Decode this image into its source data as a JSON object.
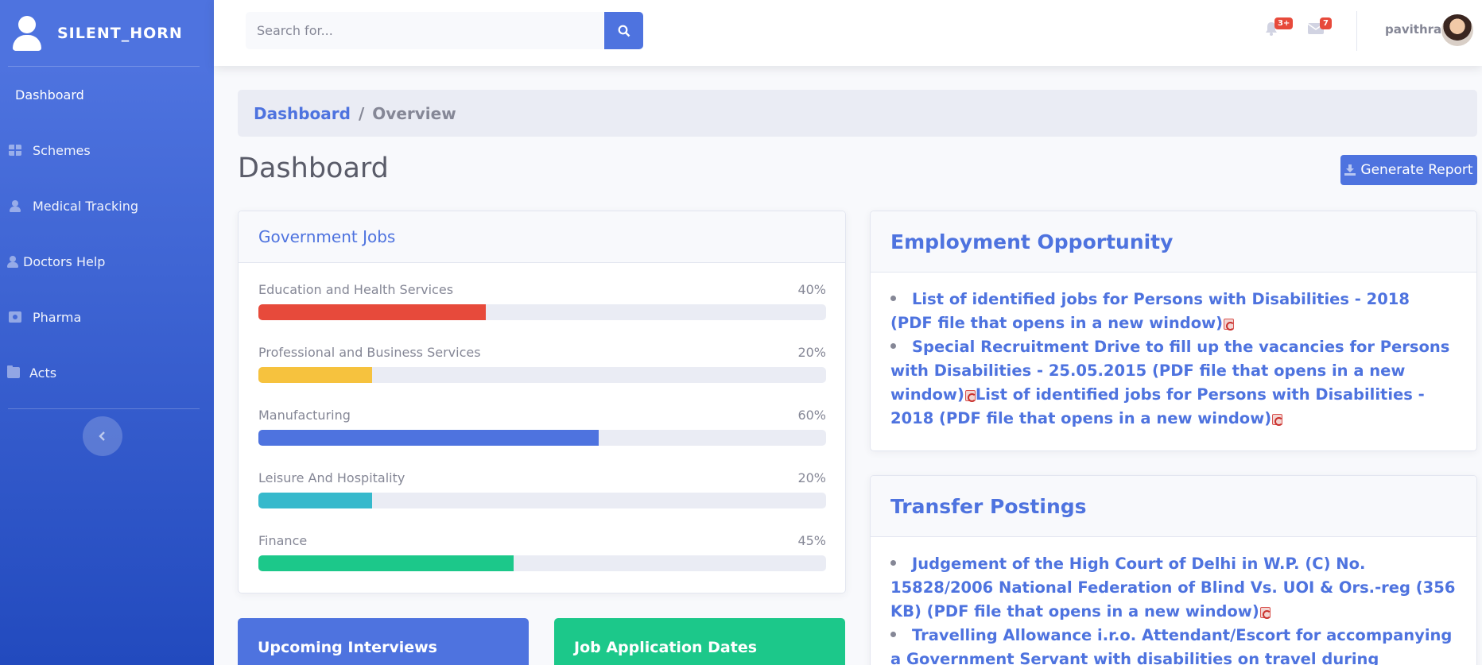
{
  "brand": {
    "name": "SILENT_HORN"
  },
  "sidebar": {
    "items": [
      {
        "label": "Dashboard",
        "icon": ""
      },
      {
        "label": "Schemes",
        "icon": "table-icon"
      },
      {
        "label": "Medical Tracking",
        "icon": "user-icon"
      },
      {
        "label": "Doctors Help",
        "icon": "user-doctor-icon"
      },
      {
        "label": "Pharma",
        "icon": "medkit-icon"
      },
      {
        "label": "Acts",
        "icon": "folder-icon"
      }
    ],
    "toggle_icon": "chevron-left-icon"
  },
  "topbar": {
    "search": {
      "placeholder": "Search for...",
      "value": ""
    },
    "alerts": {
      "count": "3+",
      "icon": "bell-icon"
    },
    "messages": {
      "count": "7",
      "icon": "envelope-icon"
    },
    "user": {
      "name": "pavithra"
    }
  },
  "breadcrumb": {
    "link": "Dashboard",
    "separator": "/",
    "active": "Overview"
  },
  "page": {
    "title": "Dashboard",
    "report_button": "Generate Report"
  },
  "government_jobs": {
    "title": "Government Jobs",
    "items": [
      {
        "label": "Education and Health Services",
        "percent_text": "40%",
        "value": 40,
        "color": "#e74a3b"
      },
      {
        "label": "Professional and Business Services",
        "percent_text": "20%",
        "value": 20,
        "color": "#f6c23e"
      },
      {
        "label": "Manufacturing",
        "percent_text": "60%",
        "value": 60,
        "color": "#4e73df"
      },
      {
        "label": "Leisure And Hospitality",
        "percent_text": "20%",
        "value": 20,
        "color": "#36b9cc"
      },
      {
        "label": "Finance",
        "percent_text": "45%",
        "value": 45,
        "color": "#1cc88a"
      }
    ]
  },
  "employment": {
    "title": "Employment Opportunity",
    "links": [
      "List of identified jobs for Persons with Disabilities - 2018 (PDF file that opens in a new window)",
      "Special Recruitment Drive to fill up the vacancies for Persons with Disabilities - 25.05.2015 (PDF file that opens in a new window)",
      "List of identified jobs for Persons with Disabilities - 2018 (PDF file that opens in a new window)"
    ]
  },
  "transfer": {
    "title": "Transfer Postings",
    "links": [
      "Judgement of the High Court of Delhi in W.P. (C) No. 15828/2006 National Federation of Blind Vs. UOI & Ors.-reg (356 KB) (PDF file that opens in a new window)",
      "Travelling Allowance i.r.o. Attendant/Escort for accompanying a Government Servant with disabilities on travel during tour/training etc. -"
    ]
  },
  "bottom_cards": {
    "interviews": "Upcoming Interviews",
    "application": "Job Application Dates"
  },
  "colors": {
    "primary": "#4e73df",
    "success": "#1cc88a",
    "danger": "#e74a3b",
    "warning": "#f6c23e",
    "info": "#36b9cc"
  }
}
